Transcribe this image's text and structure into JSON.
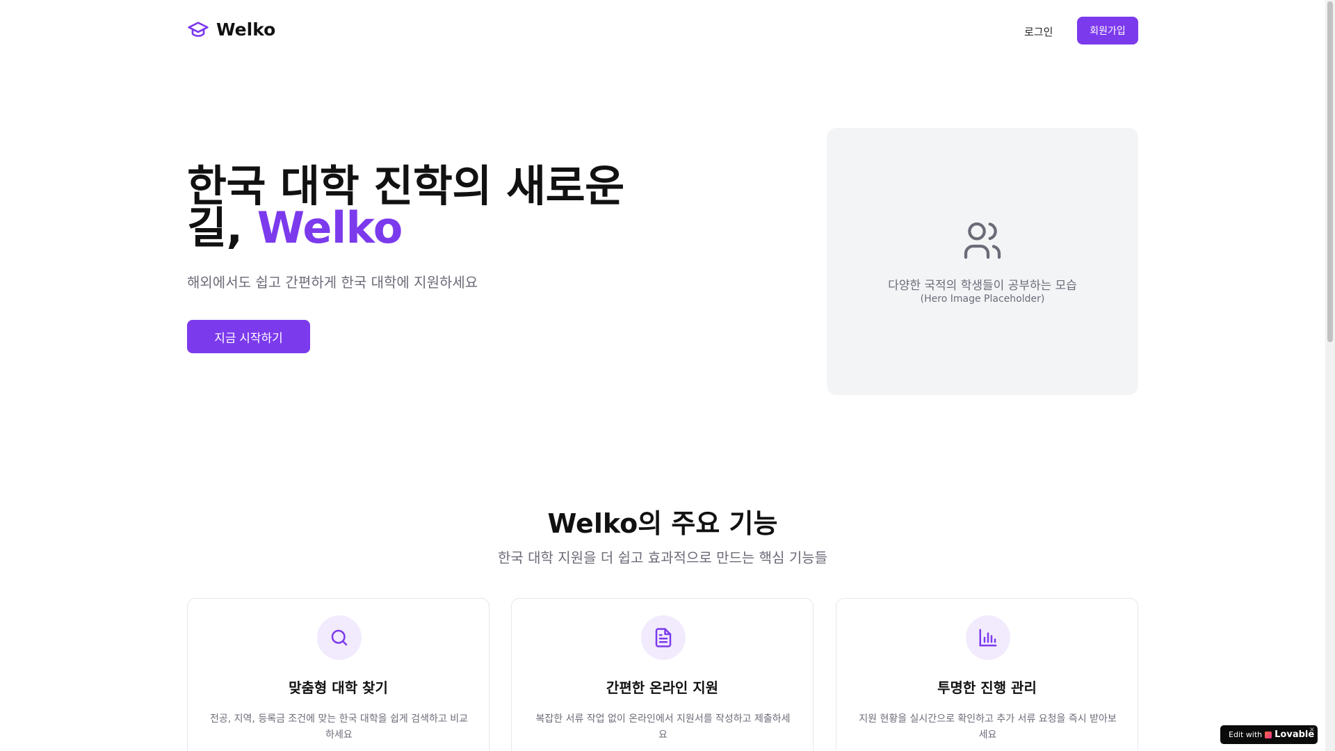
{
  "brand": {
    "name": "Welko",
    "accent_color": "#7c3aed"
  },
  "nav": {
    "login": "로그인",
    "signup": "회원가입"
  },
  "hero": {
    "title_main": "한국 대학 진학의 새로운 길, ",
    "title_accent": "Welko",
    "subtitle": "해외에서도 쉽고 간편하게 한국 대학에 지원하세요",
    "cta": "지금 시작하기",
    "image_caption": "다양한 국적의 학생들이 공부하는 모습",
    "image_placeholder": "(Hero Image Placeholder)"
  },
  "features": {
    "title": "Welko의 주요 기능",
    "subtitle": "한국 대학 지원을 더 쉽고 효과적으로 만드는 핵심 기능들",
    "cards": [
      {
        "icon": "search-icon",
        "title": "맞춤형 대학 찾기",
        "desc": "전공, 지역, 등록금 조건에 맞는 한국 대학을 쉽게 검색하고 비교하세요"
      },
      {
        "icon": "document-icon",
        "title": "간편한 온라인 지원",
        "desc": "복잡한 서류 작업 없이 온라인에서 지원서를 작성하고 제출하세요"
      },
      {
        "icon": "bar-chart-icon",
        "title": "투명한 진행 관리",
        "desc": "지원 현황을 실시간으로 확인하고 추가 서류 요청을 즉시 받아보세요"
      }
    ]
  },
  "badge": {
    "prefix": "Edit with",
    "brand": "Lovable",
    "close": "×"
  }
}
